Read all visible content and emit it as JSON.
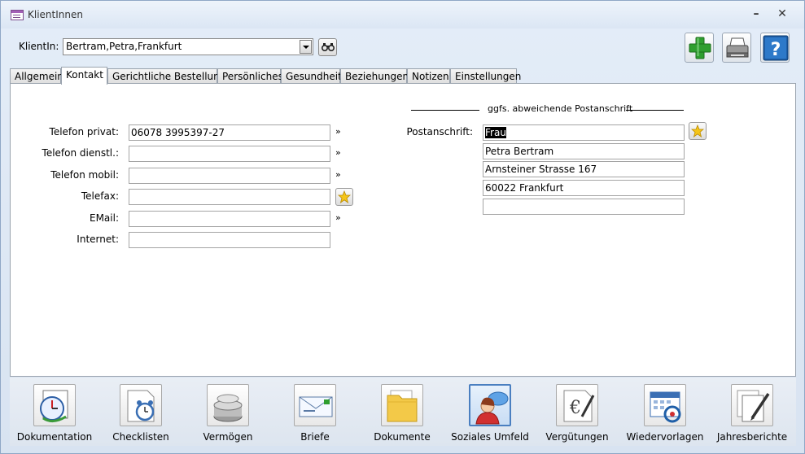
{
  "window": {
    "title": "KlientInnen",
    "minimize": "–",
    "close": "✕"
  },
  "client": {
    "label": "KlientIn:",
    "value": "Bertram,Petra,Frankfurt"
  },
  "tabs": [
    {
      "label": "Allgemein"
    },
    {
      "label": "Kontakt",
      "active": true
    },
    {
      "label": "Gerichtliche Bestellung"
    },
    {
      "label": "Persönliches"
    },
    {
      "label": "Gesundheit"
    },
    {
      "label": "Beziehungen"
    },
    {
      "label": "Notizen"
    },
    {
      "label": "Einstellungen"
    }
  ],
  "contact": {
    "telefon_privat": {
      "label": "Telefon privat:",
      "value": "06078 3995397-27"
    },
    "telefon_dienstl": {
      "label": "Telefon dienstl.:",
      "value": ""
    },
    "telefon_mobil": {
      "label": "Telefon mobil:",
      "value": ""
    },
    "telefax": {
      "label": "Telefax:",
      "value": ""
    },
    "email": {
      "label": "EMail:",
      "value": ""
    },
    "internet": {
      "label": "Internet:",
      "value": ""
    },
    "chevron": "»"
  },
  "postal": {
    "section_title": "ggfs. abweichende Postanschrift",
    "label": "Postanschrift:",
    "lines": [
      "Frau",
      "Petra Bertram",
      "Arnsteiner Strasse 167",
      "60022 Frankfurt",
      ""
    ]
  },
  "nav": [
    {
      "label": "Dokumentation",
      "icon": "clock-calendar-icon"
    },
    {
      "label": "Checklisten",
      "icon": "alarm-clock-icon"
    },
    {
      "label": "Vermögen",
      "icon": "coins-icon"
    },
    {
      "label": "Briefe",
      "icon": "envelope-icon"
    },
    {
      "label": "Dokumente",
      "icon": "folder-icon"
    },
    {
      "label": "Soziales Umfeld",
      "icon": "person-chat-icon",
      "active": true
    },
    {
      "label": "Vergütungen",
      "icon": "euro-document-icon"
    },
    {
      "label": "Wiedervorlagen",
      "icon": "calendar-refresh-icon"
    },
    {
      "label": "Jahresberichte",
      "icon": "documents-pen-icon"
    }
  ],
  "colors": {
    "add_green": "#2f9e2f",
    "help_blue": "#1f5fa8",
    "active_nav_border": "#4a7fc0"
  }
}
